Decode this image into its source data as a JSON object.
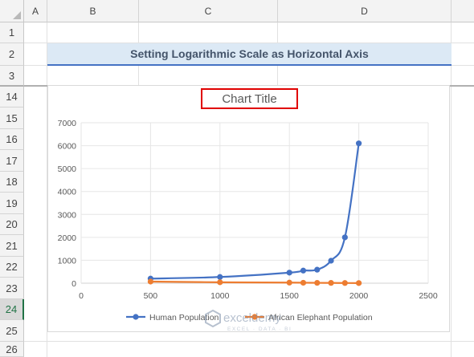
{
  "columns": [
    "A",
    "B",
    "C",
    "D"
  ],
  "rows": [
    "1",
    "2",
    "3",
    "14",
    "15",
    "16",
    "17",
    "18",
    "19",
    "20",
    "21",
    "22",
    "23",
    "24",
    "25",
    "26"
  ],
  "active_row": "24",
  "banner": {
    "text": "Setting Logarithmic Scale as Horizontal Axis"
  },
  "chart_data": {
    "type": "scatter",
    "title": "Chart Title",
    "xlim": [
      0,
      2500
    ],
    "ylim": [
      0,
      7000
    ],
    "x_ticks": [
      "0",
      "500",
      "1000",
      "1500",
      "2000",
      "2500"
    ],
    "y_ticks": [
      "0",
      "1000",
      "2000",
      "3000",
      "4000",
      "5000",
      "6000",
      "7000"
    ],
    "grid": true,
    "smooth_lines": true,
    "legend_position": "bottom",
    "series": [
      {
        "name": "Human Population",
        "color": "#4472c4",
        "points": [
          [
            500,
            200
          ],
          [
            1000,
            270
          ],
          [
            1500,
            460
          ],
          [
            1600,
            550
          ],
          [
            1700,
            590
          ],
          [
            1800,
            980
          ],
          [
            1900,
            2000
          ],
          [
            2000,
            6100
          ]
        ]
      },
      {
        "name": "African Elephant Population",
        "color": "#ed7d31",
        "points": [
          [
            500,
            70
          ],
          [
            1000,
            40
          ],
          [
            1500,
            25
          ],
          [
            1600,
            20
          ],
          [
            1700,
            15
          ],
          [
            1800,
            12
          ],
          [
            1900,
            8
          ],
          [
            2000,
            5
          ]
        ]
      }
    ]
  },
  "watermark": {
    "brand": "exceldemy",
    "tagline": "EXCEL · DATA · BI"
  }
}
